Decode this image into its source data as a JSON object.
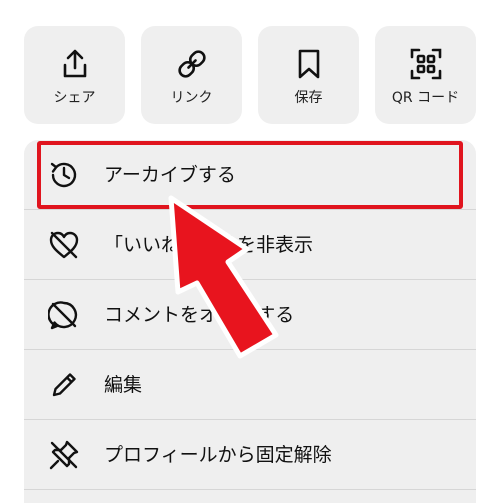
{
  "actions": [
    {
      "id": "share",
      "label": "シェア",
      "icon": "share-icon"
    },
    {
      "id": "link",
      "label": "リンク",
      "icon": "link-icon"
    },
    {
      "id": "save",
      "label": "保存",
      "icon": "bookmark-icon"
    },
    {
      "id": "qr",
      "label": "QR コード",
      "icon": "qr-code-icon"
    }
  ],
  "menu": {
    "items": [
      {
        "label": "アーカイブする",
        "icon": "archive-history-icon",
        "highlighted": true
      },
      {
        "label": "「いいね！」数を非表示",
        "icon": "heart-off-icon"
      },
      {
        "label": "コメントをオフにする",
        "icon": "comment-off-icon"
      },
      {
        "label": "編集",
        "icon": "pencil-icon"
      },
      {
        "label": "プロフィールから固定解除",
        "icon": "unpin-icon"
      }
    ]
  },
  "annotation": {
    "highlight_color": "#e0141e",
    "arrow_color": "#e8141e"
  }
}
